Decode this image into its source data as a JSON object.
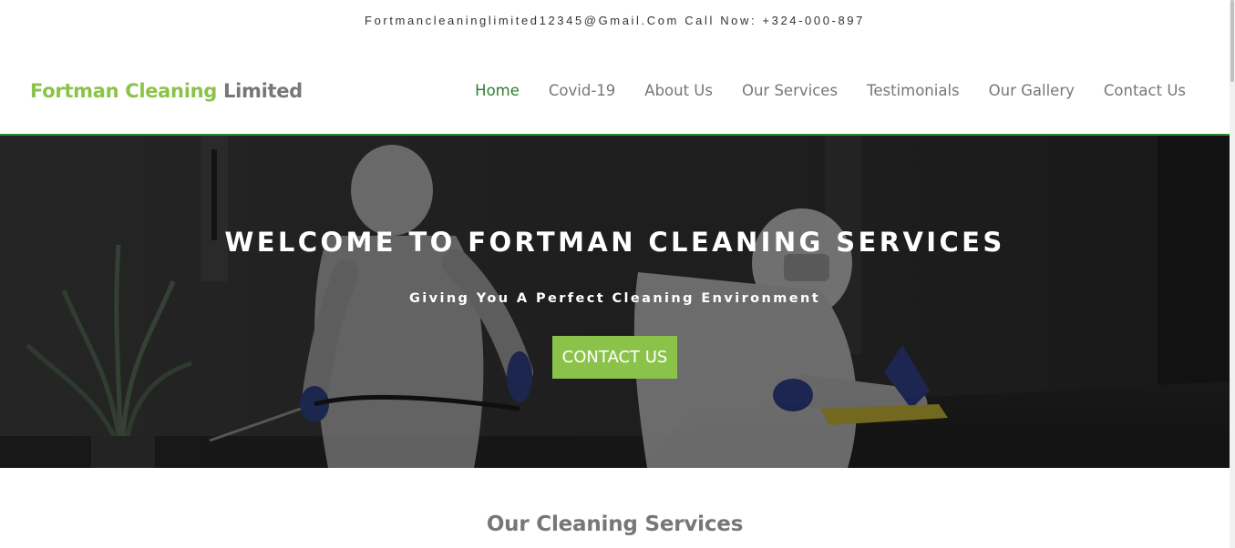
{
  "topbar": {
    "contact_line": "Fortmancleaninglimited12345@Gmail.Com Call Now: +324-000-897"
  },
  "header": {
    "logo_brand": "Fortman Cleaning",
    "logo_suffix": "Limited",
    "nav": [
      {
        "label": "Home",
        "active": true
      },
      {
        "label": "Covid-19"
      },
      {
        "label": "About Us"
      },
      {
        "label": "Our Services"
      },
      {
        "label": "Testimonials"
      },
      {
        "label": "Our Gallery"
      },
      {
        "label": "Contact Us"
      }
    ]
  },
  "hero": {
    "title": "WELCOME TO FORTMAN CLEANING SERVICES",
    "subtitle": "Giving You A Perfect Cleaning Environment",
    "button_label": "CONTACT US"
  },
  "services": {
    "title": "Our Cleaning Services"
  },
  "colors": {
    "accent_green": "#8bc34a",
    "nav_active": "#2e7d32",
    "header_border": "#2f8a2f",
    "nav_text": "#777777"
  }
}
